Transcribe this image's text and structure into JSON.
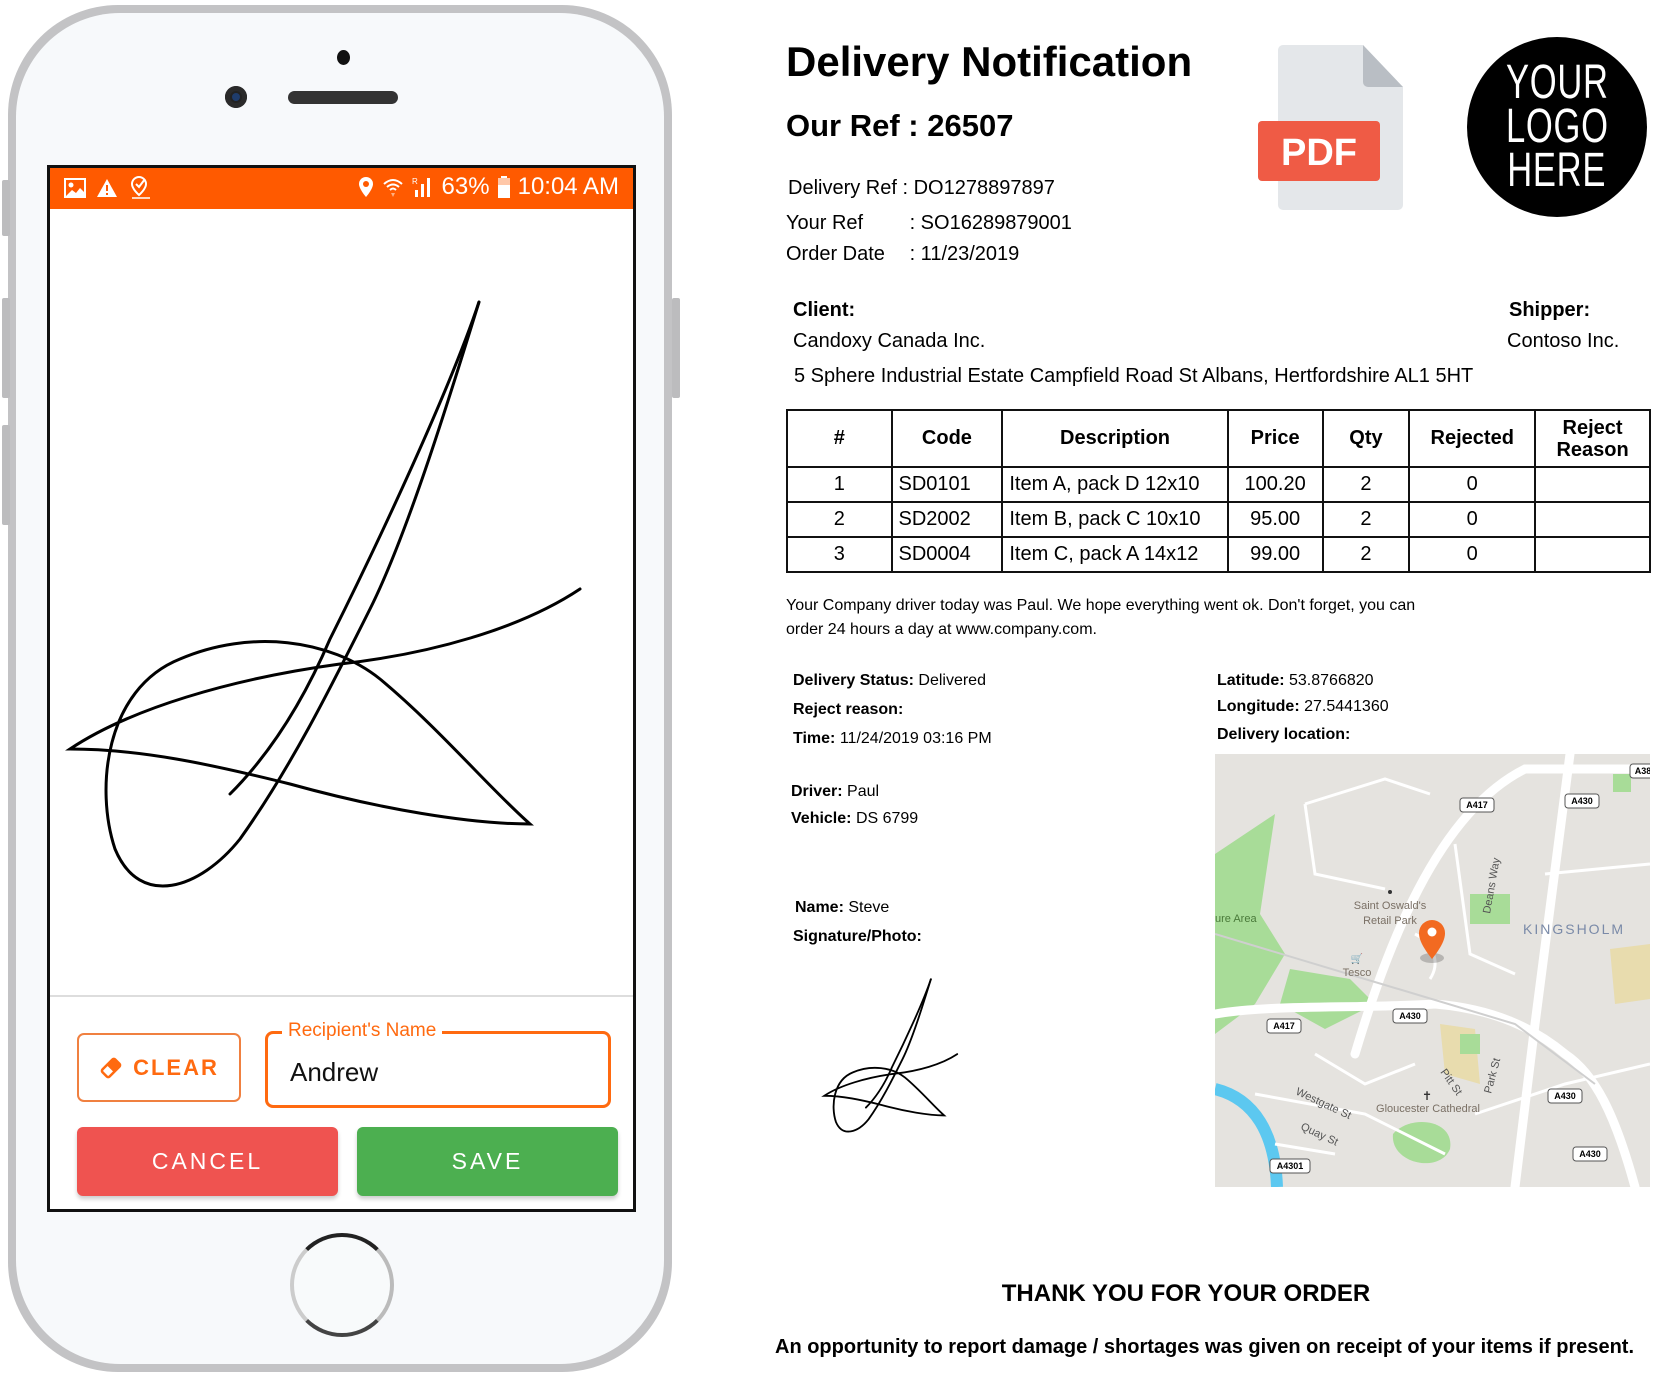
{
  "phone": {
    "status_bar": {
      "left_icons": [
        "image-icon",
        "warning-icon",
        "location-check-icon"
      ],
      "right_icons": [
        "location-pin-icon",
        "wifi-icon",
        "signal-icon"
      ],
      "battery": "63%",
      "time": "10:04 AM"
    },
    "signature_pad": {
      "label": "signature"
    },
    "clear_button": "CLEAR",
    "recipient_field": {
      "label": "Recipient's Name",
      "value": "Andrew"
    },
    "cancel_button": "CANCEL",
    "save_button": "SAVE",
    "colors": {
      "accent": "#ff5a00",
      "cancel": "#ef5350",
      "save": "#4caf50"
    }
  },
  "document": {
    "title": "Delivery Notification",
    "our_ref": "Our Ref : 26507",
    "pdf_badge": "PDF",
    "logo_lines": [
      "YOUR",
      "LOGO",
      "HERE"
    ],
    "meta": [
      {
        "label": "Delivery Ref",
        "value": ": DO1278897897"
      },
      {
        "label": "Your Ref",
        "value": ": SO16289879001"
      },
      {
        "label": "Order Date",
        "value": ": 11/23/2019"
      }
    ],
    "client": {
      "label": "Client:",
      "name": "Candoxy Canada Inc.",
      "address": "5 Sphere Industrial Estate Campfield Road St Albans, Hertfordshire AL1 5HT"
    },
    "shipper": {
      "label": "Shipper:",
      "name": "Contoso Inc."
    },
    "table": {
      "headers": [
        "#",
        "Code",
        "Description",
        "Price",
        "Qty",
        "Rejected",
        "Reject Reason"
      ],
      "rows": [
        [
          "1",
          "SD0101",
          "Item A, pack D 12x10",
          "100.20",
          "2",
          "0",
          ""
        ],
        [
          "2",
          "SD2002",
          "Item B, pack C 10x10",
          "95.00",
          "2",
          "0",
          ""
        ],
        [
          "3",
          "SD0004",
          "Item C, pack A 14x12",
          "99.00",
          "2",
          "0",
          ""
        ]
      ]
    },
    "message_line1": "Your Company driver today was Paul.  We hope everything went ok. Don't forget, you can",
    "message_line2": "order 24 hours a day at www.company.com.",
    "delivery": {
      "status_label": "Delivery Status:",
      "status": "Delivered",
      "reject_label": "Reject reason:",
      "reject": "",
      "time_label": "Time:",
      "time": "11/24/2019 03:16 PM",
      "driver_label": "Driver:",
      "driver": "Paul",
      "vehicle_label": "Vehicle:",
      "vehicle": "DS 6799",
      "name_label": "Name:",
      "name": "Steve",
      "signature_label": "Signature/Photo:"
    },
    "location": {
      "lat_label": "Latitude:",
      "lat": "53.8766820",
      "lon_label": "Longitude:",
      "lon": "27.5441360",
      "map_label": "Delivery location:",
      "map_labels": {
        "retail_park_1": "Saint Oswald's",
        "retail_park_2": "Retail Park",
        "tesco": "Tesco",
        "kingsholm": "KINGSHOLM",
        "deans_way": "Deans Way",
        "nature_area": "ure Area",
        "westgate": "Westgate St",
        "quay": "Quay St",
        "pitt": "Pitt St",
        "park": "Park St",
        "cathedral": "Gloucester Cathedral"
      },
      "road_shields": [
        "A417",
        "A430",
        "A38",
        "A417",
        "A430",
        "A430",
        "A430",
        "A4301"
      ]
    },
    "thanks": "THANK YOU FOR YOUR ORDER",
    "footer": "An opportunity to report damage / shortages was given on receipt of your items if present."
  }
}
